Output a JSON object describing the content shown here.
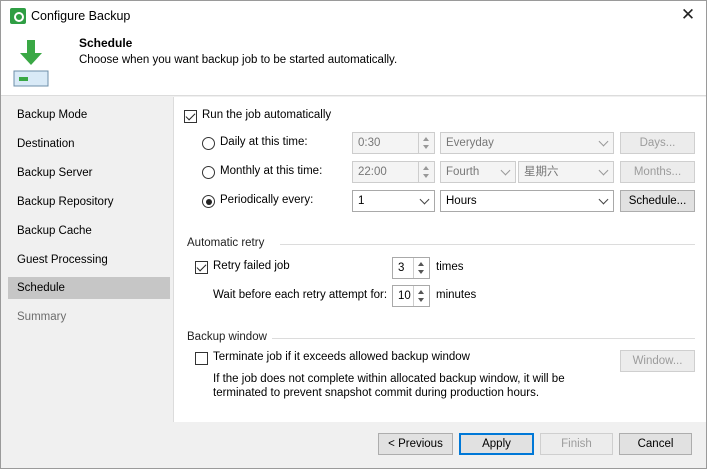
{
  "window": {
    "title": "Configure Backup",
    "close_glyph": "✕"
  },
  "header": {
    "title": "Schedule",
    "subtitle": "Choose when you want backup job to be started automatically."
  },
  "sidebar": {
    "items": [
      {
        "label": "Backup Mode"
      },
      {
        "label": "Destination"
      },
      {
        "label": "Backup Server"
      },
      {
        "label": "Backup Repository"
      },
      {
        "label": "Backup Cache"
      },
      {
        "label": "Guest Processing"
      },
      {
        "label": "Schedule"
      },
      {
        "label": "Summary"
      }
    ],
    "active_index": 6
  },
  "schedule": {
    "run_automatically": {
      "label": "Run the job automatically",
      "checked": true
    },
    "daily": {
      "label": "Daily at this time:",
      "time": "0:30",
      "days_value": "Everyday",
      "days_button": "Days..."
    },
    "monthly": {
      "label": "Monthly at this time:",
      "time": "22:00",
      "week": "Fourth",
      "day": "星期六",
      "months_button": "Months..."
    },
    "periodic": {
      "label": "Periodically every:",
      "value": "1",
      "unit": "Hours",
      "schedule_button": "Schedule..."
    }
  },
  "retry": {
    "section_label": "Automatic retry",
    "retry_label": "Retry failed job",
    "retry_checked": true,
    "times_value": "3",
    "times_unit": "times",
    "wait_label": "Wait before each retry attempt for:",
    "wait_value": "10",
    "wait_unit": "minutes"
  },
  "backup_window": {
    "section_label": "Backup window",
    "terminate_label": "Terminate job if it exceeds allowed backup window",
    "terminate_checked": false,
    "window_button": "Window...",
    "note_line1": "If the job does not complete within allocated backup window, it will be",
    "note_line2": "terminated to prevent snapshot commit during production hours."
  },
  "footer": {
    "previous": "< Previous",
    "apply": "Apply",
    "finish": "Finish",
    "cancel": "Cancel"
  },
  "colors": {
    "accent": "#0078d7",
    "icon_green": "#2f9e44",
    "selected_nav": "#c6c6c6"
  }
}
